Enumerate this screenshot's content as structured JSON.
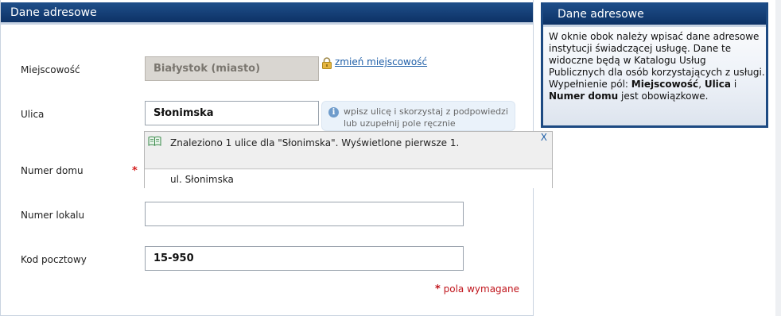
{
  "main_panel": {
    "title": "Dane adresowe"
  },
  "form": {
    "city_label": "Miejscowość",
    "city_value": "Białystok (miasto)",
    "change_city_link": "zmień miejscowość",
    "street_label": "Ulica",
    "street_value": "Słonimska",
    "street_hint": "wpisz ulicę i skorzystaj z podpowiedzi lub uzupełnij pole ręcznie",
    "house_number_label": "Numer domu",
    "house_number_value": "",
    "flat_number_label": "Numer lokalu",
    "flat_number_value": "",
    "postal_code_label": "Kod pocztowy",
    "postal_code_value": "15-950",
    "required_star": "*",
    "required_note": "pola wymagane"
  },
  "suggestions": {
    "message": "Znaleziono 1 ulice dla \"Słonimska\". Wyświetlone pierwsze 1.",
    "close_label": "X",
    "items": [
      "ul. Słonimska"
    ]
  },
  "info_box": {
    "title": "Dane adresowe",
    "text_before": "W oknie obok należy wpisać dane adresowe instytucji świadczącej usługę. Dane te widoczne będą w Katalogu Usług Publicznych dla osób korzystających z usługi. Wypełnienie pól: ",
    "bold_1": "Miejscowość",
    "sep_1": ", ",
    "bold_2": "Ulica",
    "sep_2": " i ",
    "bold_3": "Numer domu",
    "text_after": " jest obowiązkowe."
  },
  "icons": {
    "lock": "lock-icon",
    "info": "info-icon",
    "book": "book-icon"
  },
  "colors": {
    "header_blue": "#0d3266",
    "required_red": "#c0141b",
    "link_blue": "#1f5fa8"
  }
}
